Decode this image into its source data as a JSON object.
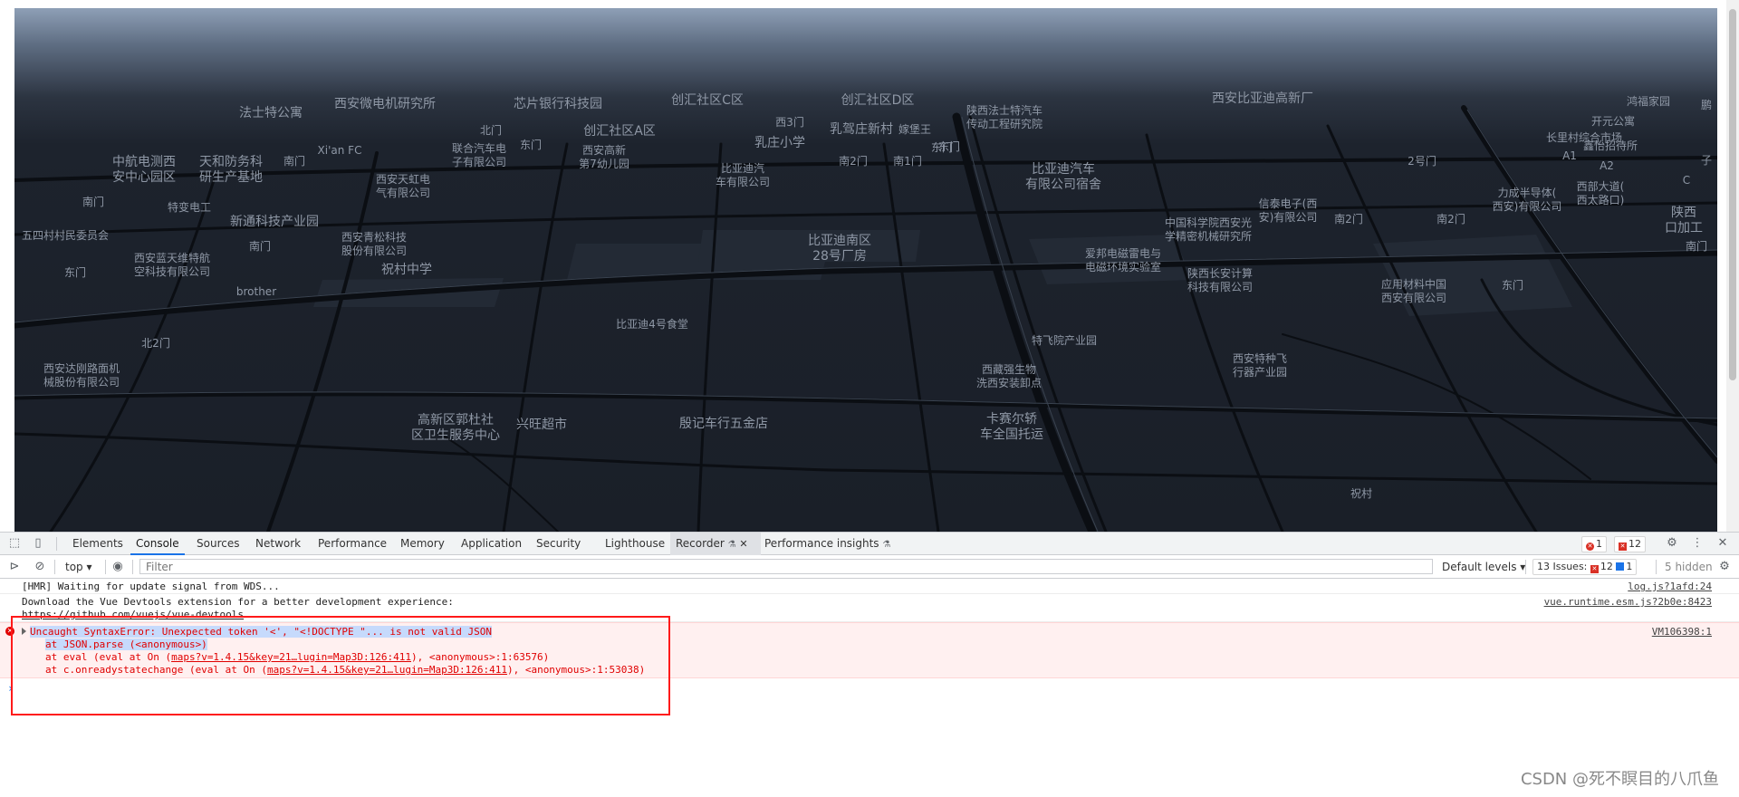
{
  "map": {
    "labels": [
      {
        "text": "法士特公寓",
        "cls": "lg"
      },
      {
        "text": "西安微电机研究所",
        "cls": "lg"
      },
      {
        "text": "芯片银行科技园",
        "cls": "lg"
      },
      {
        "text": "创汇社区C区",
        "cls": "lg"
      },
      {
        "text": "创汇社区D区",
        "cls": "lg"
      },
      {
        "text": "西安比亚迪高新厂",
        "cls": "lg"
      },
      {
        "text": "鸿福家园",
        "cls": ""
      },
      {
        "text": "中航电测西\n安中心园区",
        "cls": "lg"
      },
      {
        "text": "天和防务科\n研生产基地",
        "cls": "lg"
      },
      {
        "text": "南门",
        "cls": ""
      },
      {
        "text": "Xi'an FC",
        "cls": ""
      },
      {
        "text": "北门",
        "cls": ""
      },
      {
        "text": "联合汽车电\n子有限公司",
        "cls": ""
      },
      {
        "text": "东门",
        "cls": ""
      },
      {
        "text": "创汇社区A区",
        "cls": "lg"
      },
      {
        "text": "西安高新\n第7幼儿园",
        "cls": ""
      },
      {
        "text": "西3门",
        "cls": ""
      },
      {
        "text": "乳庄小学",
        "cls": "lg"
      },
      {
        "text": "乳驾庄新村",
        "cls": "lg"
      },
      {
        "text": "嫁堡王",
        "cls": ""
      },
      {
        "text": "陕西法士特汽车\n传动工程研究院",
        "cls": ""
      },
      {
        "text": "开元公寓",
        "cls": ""
      },
      {
        "text": "长里村综合市场",
        "cls": ""
      },
      {
        "text": "鑫怡招待所",
        "cls": ""
      },
      {
        "text": "A1",
        "cls": ""
      },
      {
        "text": "A2",
        "cls": ""
      },
      {
        "text": "东门",
        "cls": ""
      },
      {
        "text": "西安天虹电\n气有限公司",
        "cls": ""
      },
      {
        "text": "比亚迪汽\n车有限公司",
        "cls": ""
      },
      {
        "text": "南2门",
        "cls": ""
      },
      {
        "text": "南1门",
        "cls": ""
      },
      {
        "text": "东门",
        "cls": ""
      },
      {
        "text": "比亚迪汽车\n有限公司宿舍",
        "cls": "lg"
      },
      {
        "text": "2号门",
        "cls": ""
      },
      {
        "text": "南门",
        "cls": ""
      },
      {
        "text": "特变电工",
        "cls": ""
      },
      {
        "text": "力成半导体(\n西安)有限公司",
        "cls": ""
      },
      {
        "text": "西部大道(\n西太路口)",
        "cls": ""
      },
      {
        "text": "信泰电子(西\n安)有限公司",
        "cls": ""
      },
      {
        "text": "新通科技产业园",
        "cls": "lg"
      },
      {
        "text": "中国科学院西安光\n学精密机械研究所",
        "cls": ""
      },
      {
        "text": "南2门",
        "cls": ""
      },
      {
        "text": "南2门",
        "cls": ""
      },
      {
        "text": "五四村村民委员会",
        "cls": ""
      },
      {
        "text": "西安青松科技\n股份有限公司",
        "cls": ""
      },
      {
        "text": "南门",
        "cls": ""
      },
      {
        "text": "比亚迪南区\n28号厂房",
        "cls": "lg"
      },
      {
        "text": "陕西\n口加工",
        "cls": "lg"
      },
      {
        "text": "南门",
        "cls": ""
      },
      {
        "text": "西安蓝天维特航\n空科技有限公司",
        "cls": ""
      },
      {
        "text": "东门",
        "cls": ""
      },
      {
        "text": "祝村中学",
        "cls": "lg"
      },
      {
        "text": "爱邦电磁雷电与\n电磁环境实验室",
        "cls": ""
      },
      {
        "text": "陕西长安计算\n科技有限公司",
        "cls": ""
      },
      {
        "text": "应用材料中国\n西安有限公司",
        "cls": ""
      },
      {
        "text": "东门",
        "cls": ""
      },
      {
        "text": "brother",
        "cls": ""
      },
      {
        "text": "比亚迪4号食堂",
        "cls": ""
      },
      {
        "text": "北2门",
        "cls": ""
      },
      {
        "text": "特飞院产业园",
        "cls": ""
      },
      {
        "text": "西安特种飞\n行器产业园",
        "cls": ""
      },
      {
        "text": "西安达刚路面机\n械股份有限公司",
        "cls": ""
      },
      {
        "text": "西藏强生物\n洗西安装卸点",
        "cls": ""
      },
      {
        "text": "高新区郭杜社\n区卫生服务中心",
        "cls": "lg"
      },
      {
        "text": "兴旺超市",
        "cls": "lg"
      },
      {
        "text": "殷记车行五金店",
        "cls": "lg"
      },
      {
        "text": "卡赛尔轿\n车全国托运",
        "cls": "lg"
      },
      {
        "text": "祝村",
        "cls": ""
      },
      {
        "text": "C",
        "cls": ""
      },
      {
        "text": "子",
        "cls": ""
      },
      {
        "text": "鹏",
        "cls": ""
      }
    ]
  },
  "devtools": {
    "tabs": [
      "Elements",
      "Console",
      "Sources",
      "Network",
      "Performance",
      "Memory",
      "Application",
      "Security",
      "Lighthouse",
      "Recorder",
      "Performance insights"
    ],
    "error_count": "1",
    "warning_count": "12",
    "context": "top",
    "filter_placeholder": "Filter",
    "levels": "Default levels",
    "issues_label": "13 Issues:",
    "issues_warn": "12",
    "issues_info": "1",
    "hidden": "5 hidden"
  },
  "console": {
    "msg1": {
      "text": "[HMR] Waiting for update signal from WDS...",
      "src": "log.js?1afd:24"
    },
    "msg2": {
      "text": "Download the Vue Devtools extension for a better development experience:",
      "link": "https://github.com/vuejs/vue-devtools",
      "src": "vue.runtime.esm.js?2b0e:8423"
    },
    "error": {
      "line1": "Uncaught SyntaxError: Unexpected token '<', \"<!DOCTYPE \"... is not valid JSON",
      "line2": "at JSON.parse (<anonymous>)",
      "line3_pre": "at eval (eval at On (",
      "line3_link": "maps?v=1.4.15&key=21…lugin=Map3D:126:411",
      "line3_post": "), <anonymous>:1:63576)",
      "line4_pre": "at c.onreadystatechange (eval at On (",
      "line4_link": "maps?v=1.4.15&key=21…lugin=Map3D:126:411",
      "line4_post": "), <anonymous>:1:53038)",
      "src": "VM106398:1"
    },
    "prompt": "›"
  },
  "watermark": "CSDN @死不瞑目的八爪鱼"
}
